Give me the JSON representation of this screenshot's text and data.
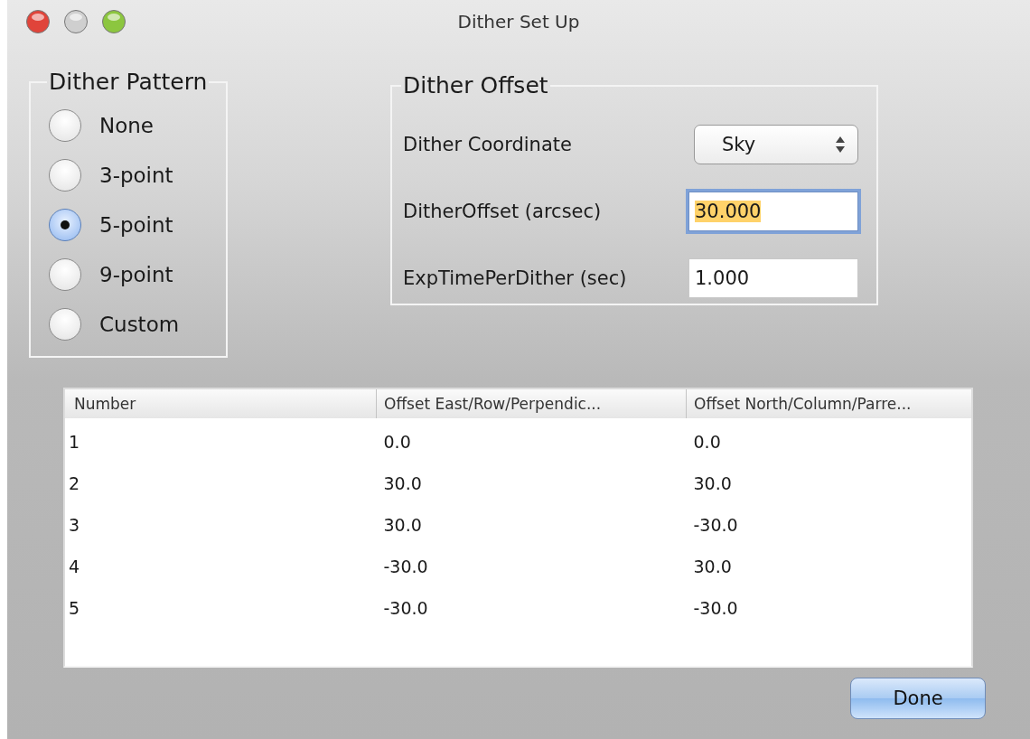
{
  "window": {
    "title": "Dither Set Up"
  },
  "dither_pattern": {
    "title": "Dither Pattern",
    "options": [
      {
        "label": "None",
        "selected": false
      },
      {
        "label": "3-point",
        "selected": false
      },
      {
        "label": "5-point",
        "selected": true
      },
      {
        "label": "9-point",
        "selected": false
      },
      {
        "label": "Custom",
        "selected": false
      }
    ]
  },
  "dither_offset": {
    "title": "Dither Offset",
    "fields": [
      {
        "kind": "select",
        "label": "Dither Coordinate",
        "value": "Sky"
      },
      {
        "kind": "input",
        "label": "DitherOffset (arcsec)",
        "value": "30.000",
        "focused": true
      },
      {
        "kind": "input",
        "label": "ExpTimePerDither (sec)",
        "value": "1.000",
        "focused": false
      }
    ]
  },
  "table": {
    "columns": [
      "Number",
      "Offset East/Row/Perpendic...",
      "Offset North/Column/Parre..."
    ],
    "rows": [
      [
        "1",
        "0.0",
        "0.0"
      ],
      [
        "2",
        "30.0",
        "30.0"
      ],
      [
        "3",
        "30.0",
        "-30.0"
      ],
      [
        "4",
        "-30.0",
        "30.0"
      ],
      [
        "5",
        "-30.0",
        "-30.0"
      ]
    ]
  },
  "buttons": [
    {
      "label": "Done",
      "default": true
    }
  ]
}
